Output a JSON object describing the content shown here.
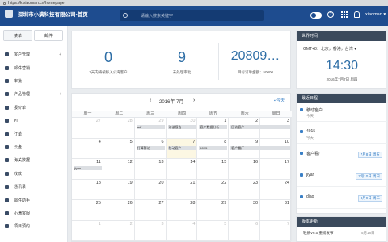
{
  "browser": {
    "url": "https://k.xiaoman.cn/homepage"
  },
  "header": {
    "brand": "深圳市小满科技有限公司•首页",
    "search_placeholder": "请输入搜索关键字",
    "user": "xiaoman"
  },
  "sidebar": {
    "tabs": [
      "菜单",
      "邮件"
    ],
    "items": [
      {
        "label": "客户管理",
        "arrow": "+"
      },
      {
        "label": "邮件营销",
        "arrow": ""
      },
      {
        "label": "审批",
        "arrow": ""
      },
      {
        "label": "产品管理",
        "arrow": "+"
      },
      {
        "label": "报价单",
        "arrow": ""
      },
      {
        "label": "PI",
        "arrow": ""
      },
      {
        "label": "订单",
        "arrow": ""
      },
      {
        "label": "云盘",
        "arrow": ""
      },
      {
        "label": "海关数据",
        "arrow": ""
      },
      {
        "label": "收款",
        "arrow": ""
      },
      {
        "label": "通讯录",
        "arrow": ""
      },
      {
        "label": "邮件助手",
        "arrow": ""
      },
      {
        "label": "小满客服",
        "arrow": ""
      },
      {
        "label": "项目预约",
        "arrow": ""
      }
    ]
  },
  "stats": [
    {
      "value": "0",
      "label": "7天内将被移入公海客户"
    },
    {
      "value": "9",
      "label": "未处理审批"
    },
    {
      "value": "20809…",
      "label": "目标订单金额：50000"
    }
  ],
  "calendar": {
    "title": "2016年 7月",
    "prev": "‹",
    "next": "›",
    "today_label": "今天",
    "weekdays": [
      "周一",
      "周二",
      "周三",
      "周四",
      "周五",
      "周六",
      "周日"
    ],
    "weeks": [
      [
        {
          "d": "27",
          "m": 1
        },
        {
          "d": "28",
          "m": 1
        },
        {
          "d": "29",
          "m": 1
        },
        {
          "d": "30",
          "m": 1
        },
        {
          "d": "1",
          "m": 0
        },
        {
          "d": "2",
          "m": 0
        },
        {
          "d": "3",
          "m": 0
        }
      ],
      [
        {
          "d": "4",
          "m": 0
        },
        {
          "d": "5",
          "m": 0
        },
        {
          "d": "6",
          "m": 0
        },
        {
          "d": "7",
          "m": 0,
          "today": 1
        },
        {
          "d": "8",
          "m": 0
        },
        {
          "d": "9",
          "m": 0
        },
        {
          "d": "10",
          "m": 0
        }
      ],
      [
        {
          "d": "11",
          "m": 0
        },
        {
          "d": "12",
          "m": 0
        },
        {
          "d": "13",
          "m": 0
        },
        {
          "d": "14",
          "m": 0
        },
        {
          "d": "15",
          "m": 0
        },
        {
          "d": "16",
          "m": 0
        },
        {
          "d": "17",
          "m": 0
        }
      ],
      [
        {
          "d": "18",
          "m": 0
        },
        {
          "d": "19",
          "m": 0
        },
        {
          "d": "20",
          "m": 0
        },
        {
          "d": "21",
          "m": 0
        },
        {
          "d": "22",
          "m": 0
        },
        {
          "d": "23",
          "m": 0
        },
        {
          "d": "24",
          "m": 0
        }
      ],
      [
        {
          "d": "25",
          "m": 0
        },
        {
          "d": "26",
          "m": 0
        },
        {
          "d": "27",
          "m": 0
        },
        {
          "d": "28",
          "m": 0
        },
        {
          "d": "29",
          "m": 0
        },
        {
          "d": "30",
          "m": 0
        },
        {
          "d": "31",
          "m": 0
        }
      ],
      [
        {
          "d": "1",
          "m": 1
        },
        {
          "d": "2",
          "m": 1
        },
        {
          "d": "3",
          "m": 1
        },
        {
          "d": "4",
          "m": 1
        },
        {
          "d": "5",
          "m": 1
        },
        {
          "d": "6",
          "m": 1
        },
        {
          "d": "7",
          "m": 1
        }
      ]
    ],
    "events": [
      {
        "text": "adf",
        "week": 0,
        "col": 2,
        "span": 1,
        "row": 0
      },
      {
        "text": "访谈报告",
        "week": 0,
        "col": 3,
        "span": 1,
        "row": 0
      },
      {
        "text": "客户数据分析",
        "week": 0,
        "col": 4,
        "span": 1,
        "row": 0
      },
      {
        "text": "回访客户",
        "week": 0,
        "col": 5,
        "span": 2,
        "row": 0
      },
      {
        "text": "打算拜访",
        "week": 1,
        "col": 2,
        "span": 1,
        "row": 0
      },
      {
        "text": "移动客户",
        "week": 1,
        "col": 3,
        "span": 1,
        "row": 0
      },
      {
        "text": "4015",
        "week": 1,
        "col": 4,
        "span": 1,
        "row": 0
      },
      {
        "text": "客户看厂",
        "week": 1,
        "col": 5,
        "span": 2,
        "row": 0
      },
      {
        "text": "jiyan",
        "week": 2,
        "col": 0,
        "span": 1,
        "row": 0
      }
    ]
  },
  "clock": {
    "title": "世界时间",
    "timezone": "GMT+8：北京，香港，台湾 ▾",
    "time": "14:30",
    "date": "2016年7月7日 周四"
  },
  "schedule": {
    "title": "最近日程",
    "items": [
      {
        "name": "移动客户",
        "date": "今天",
        "badge": ""
      },
      {
        "name": "4015",
        "date": "今天",
        "badge": ""
      },
      {
        "name": "客户看厂",
        "date": "",
        "badge": "7月8日 周五"
      },
      {
        "name": "jiyan",
        "date": "",
        "badge": "7月10日 周日"
      },
      {
        "name": "diao",
        "date": "",
        "badge": "8月9日 周二"
      }
    ]
  },
  "version": {
    "title": "版本更新",
    "text": "轻质V6.0 重磅发布",
    "date": "5月18日"
  }
}
